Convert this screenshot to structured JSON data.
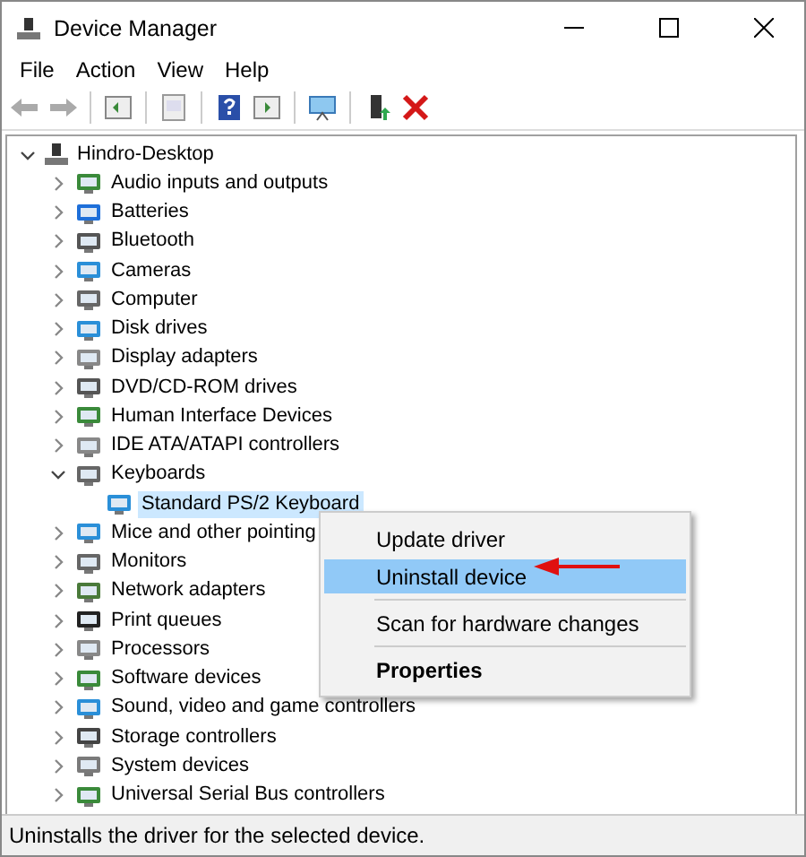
{
  "window": {
    "title": "Device Manager"
  },
  "menu_bar": [
    "File",
    "Action",
    "View",
    "Help"
  ],
  "tree": [
    {
      "label": "Hindro-Desktop",
      "expanded": true,
      "selected": false,
      "children": [
        {
          "label": "Audio inputs and outputs",
          "expanded": false,
          "selected": false
        },
        {
          "label": "Batteries",
          "expanded": false,
          "selected": false
        },
        {
          "label": "Bluetooth",
          "expanded": false,
          "selected": false
        },
        {
          "label": "Cameras",
          "expanded": false,
          "selected": false
        },
        {
          "label": "Computer",
          "expanded": false,
          "selected": false
        },
        {
          "label": "Disk drives",
          "expanded": false,
          "selected": false
        },
        {
          "label": "Display adapters",
          "expanded": false,
          "selected": false
        },
        {
          "label": "DVD/CD-ROM drives",
          "expanded": false,
          "selected": false
        },
        {
          "label": "Human Interface Devices",
          "expanded": false,
          "selected": false
        },
        {
          "label": "IDE ATA/ATAPI controllers",
          "expanded": false,
          "selected": false
        },
        {
          "label": "Keyboards",
          "expanded": true,
          "selected": false,
          "children": [
            {
              "label": "Standard PS/2 Keyboard",
              "selected": true
            }
          ]
        },
        {
          "label": "Mice and other pointing",
          "expanded": false,
          "selected": false
        },
        {
          "label": "Monitors",
          "expanded": false,
          "selected": false
        },
        {
          "label": "Network adapters",
          "expanded": false,
          "selected": false
        },
        {
          "label": "Print queues",
          "expanded": false,
          "selected": false
        },
        {
          "label": "Processors",
          "expanded": false,
          "selected": false
        },
        {
          "label": "Software devices",
          "expanded": false,
          "selected": false
        },
        {
          "label": "Sound, video and game controllers",
          "expanded": false,
          "selected": false
        },
        {
          "label": "Storage controllers",
          "expanded": false,
          "selected": false
        },
        {
          "label": "System devices",
          "expanded": false,
          "selected": false
        },
        {
          "label": "Universal Serial Bus controllers",
          "expanded": false,
          "selected": false
        }
      ]
    }
  ],
  "context_menu": [
    {
      "kind": "item",
      "label": "Update driver",
      "selected": false,
      "bold": false
    },
    {
      "kind": "item",
      "label": "Uninstall device",
      "selected": true,
      "bold": false
    },
    {
      "kind": "separator"
    },
    {
      "kind": "item",
      "label": "Scan for hardware changes",
      "selected": false,
      "bold": false
    },
    {
      "kind": "separator"
    },
    {
      "kind": "item",
      "label": "Properties",
      "selected": false,
      "bold": true
    }
  ],
  "status_bar": "Uninstalls the driver for the selected device."
}
